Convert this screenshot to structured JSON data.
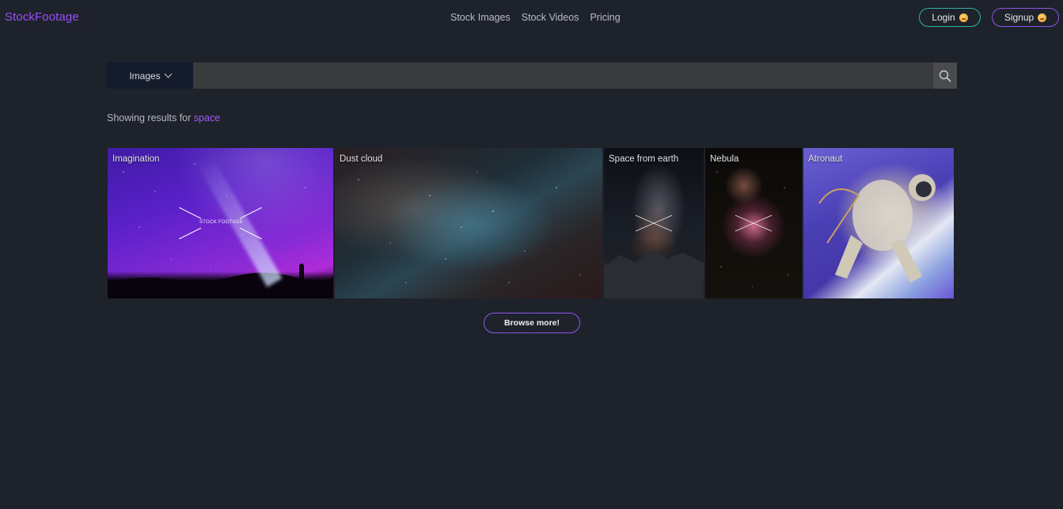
{
  "brand": {
    "name": "StockFootage",
    "color": "#9a4dff"
  },
  "nav": [
    "Stock Images",
    "Stock Videos",
    "Pricing"
  ],
  "auth": {
    "login": "Login",
    "signup": "Signup"
  },
  "search": {
    "type": "Images",
    "value": "",
    "placeholder": ""
  },
  "results": {
    "prefix": "Showing results for",
    "term": "space"
  },
  "images": [
    {
      "caption": "Imagination",
      "watermark": "STOCK FOOTAGE"
    },
    {
      "caption": "Dust cloud"
    },
    {
      "caption": "Space from earth"
    },
    {
      "caption": "Nebula"
    },
    {
      "caption": "Atronaut"
    }
  ],
  "browse_label": "Browse more!",
  "colors": {
    "accent": "#a259ff",
    "login_border": "#2fb3a3",
    "background": "#1e222a"
  }
}
